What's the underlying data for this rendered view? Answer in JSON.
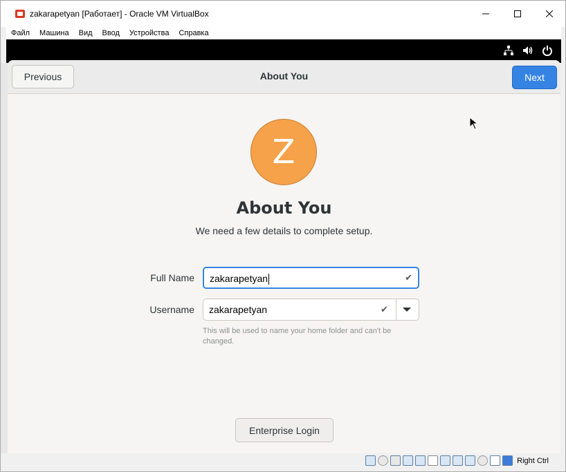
{
  "window": {
    "title": "zakarapetyan [Работает] - Oracle VM VirtualBox",
    "controls": {
      "minimize": "—",
      "maximize": "☐",
      "close": "✕"
    }
  },
  "menubar": {
    "items": [
      "Файл",
      "Машина",
      "Вид",
      "Ввод",
      "Устройства",
      "Справка"
    ]
  },
  "tray": {
    "icons": [
      "network-icon",
      "volume-icon",
      "power-icon"
    ]
  },
  "header": {
    "previous_label": "Previous",
    "title": "About You",
    "next_label": "Next",
    "accent": "#3584e4"
  },
  "main": {
    "avatar_letter": "Z",
    "avatar_color": "#f6a24a",
    "heading": "About You",
    "subtitle": "We need a few details to complete setup.",
    "full_name": {
      "label": "Full Name",
      "value": "zakarapetyan"
    },
    "username": {
      "label": "Username",
      "value": "zakarapetyan",
      "hint": "This will be used to name your home folder and can't be changed."
    },
    "enterprise_login_label": "Enterprise Login"
  },
  "statusbar": {
    "host_key": "Right Ctrl"
  }
}
